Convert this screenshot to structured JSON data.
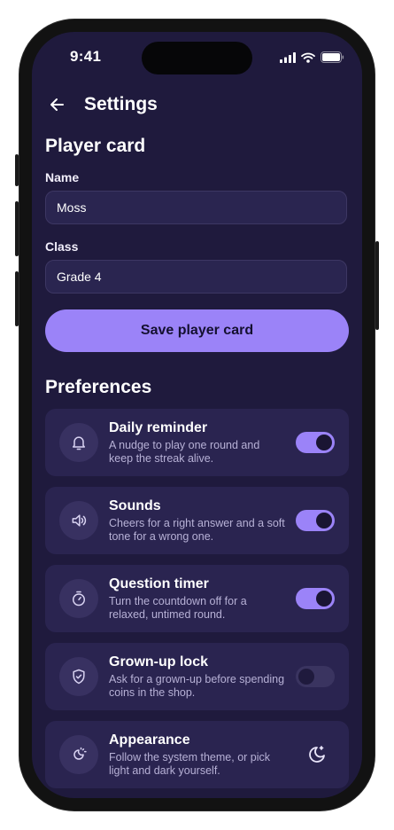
{
  "status": {
    "time": "9:41"
  },
  "header": {
    "title": "Settings",
    "back_icon": "arrow-left-icon"
  },
  "player_card": {
    "title": "Player card",
    "name_label": "Name",
    "name_value": "Moss",
    "class_label": "Class",
    "class_value": "Grade 4",
    "save_label": "Save player card"
  },
  "preferences": {
    "title": "Preferences",
    "items": [
      {
        "icon": "bell-icon",
        "title": "Daily reminder",
        "desc": "A nudge to play one round and keep the streak alive.",
        "toggle": true
      },
      {
        "icon": "speaker-icon",
        "title": "Sounds",
        "desc": "Cheers for a right answer and a soft tone for a wrong one.",
        "toggle": true
      },
      {
        "icon": "stopwatch-icon",
        "title": "Question timer",
        "desc": "Turn the countdown off for a relaxed, untimed round.",
        "toggle": true
      },
      {
        "icon": "shield-check-icon",
        "title": "Grown-up lock",
        "desc": "Ask for a grown-up before spending coins in the shop.",
        "toggle": false
      },
      {
        "icon": "sun-moon-icon",
        "title": "Appearance",
        "desc": "Follow the system theme, or pick light and dark yourself.",
        "action_icon": "moon-icon"
      }
    ]
  },
  "colors": {
    "background": "#1f1a3d",
    "accent": "#9b83f8",
    "card": "#2a2450",
    "muted_text": "#b7b1d6"
  }
}
